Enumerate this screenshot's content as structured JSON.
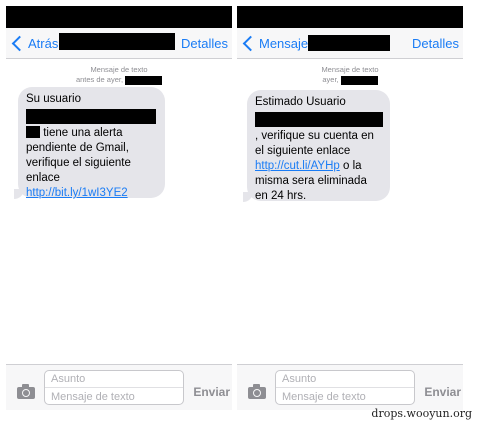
{
  "left": {
    "back_label": "Atrás",
    "details_label": "Detalles",
    "meta_line1": "Mensaje de texto",
    "meta_line2": "antes de ayer,",
    "bubble": {
      "line_first": "Su usuario",
      "after_redact": "tiene una alerta pendiente de Gmail, verifique el siguiente enlace ",
      "link": "http://bit.ly/1wI3YE2"
    },
    "composer": {
      "subject_placeholder": "Asunto",
      "message_placeholder": "Mensaje de texto",
      "send_label": "Enviar"
    }
  },
  "right": {
    "back_label": "Mensajes",
    "details_label": "Detalles",
    "meta_line1": "Mensaje de texto",
    "meta_line2": "ayer,",
    "bubble": {
      "line_first": "Estimado Usuario",
      "after_redact": ", verifique su cuenta en el siguiente enlace ",
      "link": "http://cut.li/AYHp",
      "after_link": " o la misma sera eliminada en 24 hrs."
    },
    "composer": {
      "subject_placeholder": "Asunto",
      "message_placeholder": "Mensaje de texto",
      "send_label": "Enviar"
    }
  },
  "watermark": "drops.wooyun.org",
  "icons": {
    "back": "chevron-left-icon",
    "camera": "camera-icon"
  },
  "colors": {
    "accent": "#1a7cf5",
    "bubble": "#e5e5ea",
    "redaction": "#000000"
  }
}
